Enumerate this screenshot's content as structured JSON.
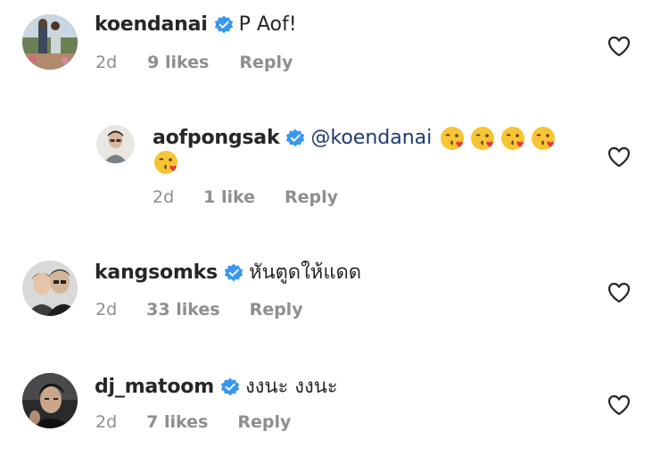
{
  "colors": {
    "text": "#262626",
    "meta": "#8e8e8e",
    "verified": "#3897f0",
    "mention": "#1e3b70"
  },
  "comments": [
    {
      "username": "koendanai",
      "verified": true,
      "text": "P Aof!",
      "time": "2d",
      "likes": "9 likes",
      "reply": "Reply",
      "avatar": "avatar-photo"
    },
    {
      "username": "aofpongsak",
      "verified": true,
      "mention": "@koendanai",
      "emojis": [
        "kiss-emoji",
        "kiss-emoji",
        "kiss-emoji",
        "kiss-emoji",
        "kiss-emoji"
      ],
      "time": "2d",
      "likes": "1 like",
      "reply": "Reply",
      "avatar": "avatar-photo"
    },
    {
      "username": "kangsomks",
      "verified": true,
      "text": "หันตูดให้แดด",
      "time": "2d",
      "likes": "33 likes",
      "reply": "Reply",
      "avatar": "avatar-photo"
    },
    {
      "username": "dj_matoom",
      "verified": true,
      "text": "งงนะ งงนะ",
      "time": "2d",
      "likes": "7 likes",
      "reply": "Reply",
      "avatar": "avatar-photo"
    }
  ]
}
